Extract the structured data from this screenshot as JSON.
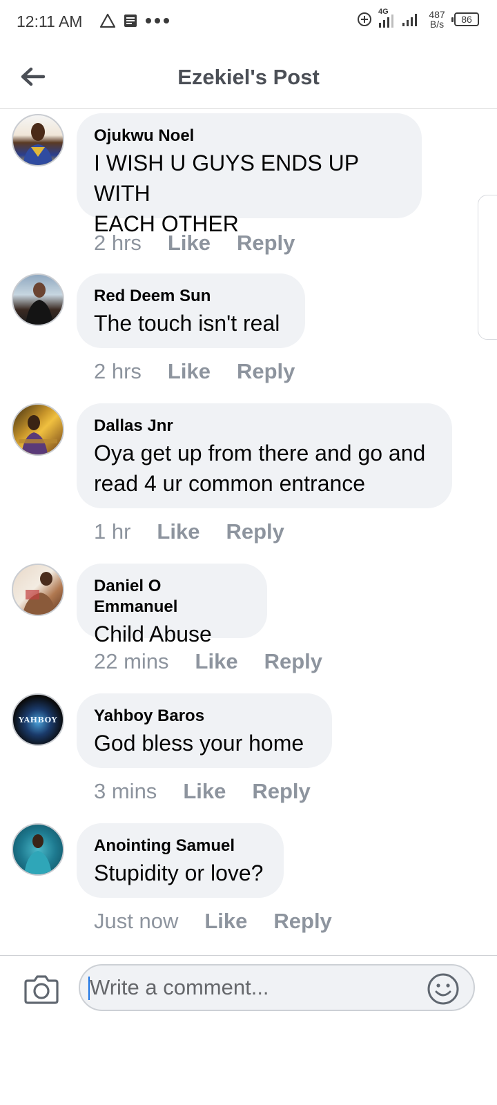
{
  "status_bar": {
    "time": "12:11 AM",
    "network": "4G",
    "speed_value": "487",
    "speed_unit": "B/s",
    "battery": "86"
  },
  "header": {
    "title": "Ezekiel's Post",
    "back_icon": "arrow-left-icon"
  },
  "comments": [
    {
      "author": "Ojukwu Noel",
      "lines": [
        "I WISH U GUYS ENDS UP WITH",
        "EACH OTHER"
      ],
      "time": "2 hrs",
      "like": "Like",
      "reply": "Reply"
    },
    {
      "author": "Red Deem Sun",
      "lines": [
        "The touch isn't real"
      ],
      "time": "2 hrs",
      "like": "Like",
      "reply": "Reply"
    },
    {
      "author": "Dallas Jnr",
      "lines": [
        "Oya get up from there and go and",
        "read 4 ur common entrance"
      ],
      "time": "1 hr",
      "like": "Like",
      "reply": "Reply"
    },
    {
      "author": "Daniel O Emmanuel",
      "lines": [
        "Child Abuse"
      ],
      "time": "22 mins",
      "like": "Like",
      "reply": "Reply"
    },
    {
      "author": "Yahboy Baros",
      "lines": [
        "God bless your home"
      ],
      "time": "3 mins",
      "like": "Like",
      "reply": "Reply",
      "avatar_text": "YAHBOY"
    },
    {
      "author": "Anointing Samuel",
      "lines": [
        "Stupidity or love?"
      ],
      "time": "Just now",
      "like": "Like",
      "reply": "Reply"
    }
  ],
  "composer": {
    "placeholder": "Write a comment...",
    "camera_icon": "camera-icon",
    "emoji_icon": "smiley-icon"
  },
  "colors": {
    "bubble_bg": "#f0f2f5",
    "meta_text": "#8d949e",
    "header_text": "#4b4f56",
    "cursor": "#1b74e4"
  }
}
